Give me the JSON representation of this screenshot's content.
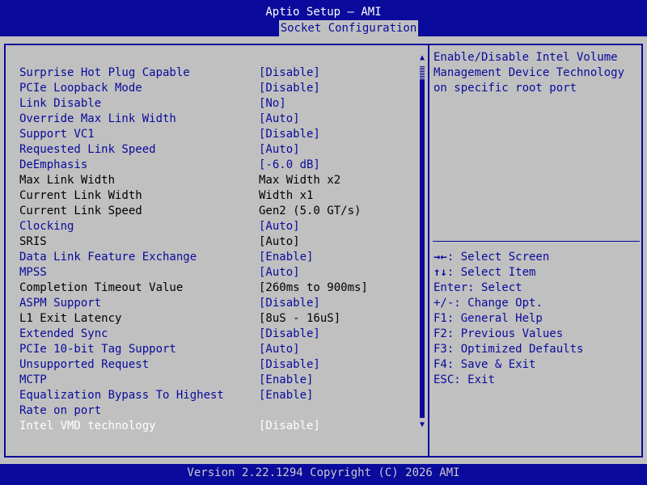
{
  "header": {
    "app_title": "Aptio Setup – AMI",
    "active_tab": "Socket Configuration"
  },
  "colors": {
    "bios_blue": "#0a0a9c",
    "background_gray": "#c0c0c0",
    "selected_white": "#ffffff"
  },
  "settings": [
    {
      "label": "Surprise Hot Plug Capable",
      "value": "[Disable]",
      "type": "option"
    },
    {
      "label": "PCIe Loopback Mode",
      "value": "[Disable]",
      "type": "option"
    },
    {
      "label": "Link Disable",
      "value": "[No]",
      "type": "option"
    },
    {
      "label": "Override Max Link Width",
      "value": "[Auto]",
      "type": "option"
    },
    {
      "label": "Support VC1",
      "value": "[Disable]",
      "type": "option"
    },
    {
      "label": "Requested Link Speed",
      "value": "[Auto]",
      "type": "option"
    },
    {
      "label": "DeEmphasis",
      "value": "[-6.0 dB]",
      "type": "option"
    },
    {
      "label": "Max Link Width",
      "value": "Max Width x2",
      "type": "info"
    },
    {
      "label": "Current Link Width",
      "value": "Width x1",
      "type": "info"
    },
    {
      "label": "Current Link Speed",
      "value": "Gen2 (5.0 GT/s)",
      "type": "info"
    },
    {
      "label": "Clocking",
      "value": "[Auto]",
      "type": "option"
    },
    {
      "label": "SRIS",
      "value": "[Auto]",
      "type": "readonly"
    },
    {
      "label": "Data Link Feature Exchange",
      "value": "[Enable]",
      "type": "option"
    },
    {
      "label": "MPSS",
      "value": "[Auto]",
      "type": "option"
    },
    {
      "label": "Completion Timeout Value",
      "value": "[260ms to 900ms]",
      "type": "readonly"
    },
    {
      "label": "ASPM Support",
      "value": "[Disable]",
      "type": "option"
    },
    {
      "label": "L1 Exit Latency",
      "value": "[8uS - 16uS]",
      "type": "readonly"
    },
    {
      "label": "Extended Sync",
      "value": "[Disable]",
      "type": "option"
    },
    {
      "label": "PCIe 10-bit Tag Support",
      "value": "[Auto]",
      "type": "option"
    },
    {
      "label": "Unsupported Request",
      "value": "[Disable]",
      "type": "option"
    },
    {
      "label": "MCTP",
      "value": "[Enable]",
      "type": "option"
    },
    {
      "label": "Equalization Bypass To Highest",
      "value": "[Enable]",
      "type": "option"
    },
    {
      "label": "Rate on port",
      "value": "",
      "type": "option"
    },
    {
      "label": "Intel VMD technology",
      "value": "[Disable]",
      "type": "selected"
    }
  ],
  "help": {
    "description": "Enable/Disable Intel Volume\nManagement Device Technology\non specific root port"
  },
  "keys": [
    {
      "key": "→←",
      "desc": ": Select Screen"
    },
    {
      "key": "↑↓",
      "desc": ": Select Item"
    },
    {
      "key": "Enter",
      "desc": ": Select"
    },
    {
      "key": "+/-",
      "desc": ": Change Opt."
    },
    {
      "key": "F1",
      "desc": ": General Help"
    },
    {
      "key": "F2",
      "desc": ": Previous Values"
    },
    {
      "key": "F3",
      "desc": ": Optimized Defaults"
    },
    {
      "key": "F4",
      "desc": ": Save & Exit"
    },
    {
      "key": "ESC",
      "desc": ": Exit"
    }
  ],
  "scrollbar": {
    "up_icon": "▲",
    "down_icon": "▼",
    "position": 0.0
  },
  "footer": {
    "version": "Version 2.22.1294 Copyright (C) 2026 AMI"
  }
}
